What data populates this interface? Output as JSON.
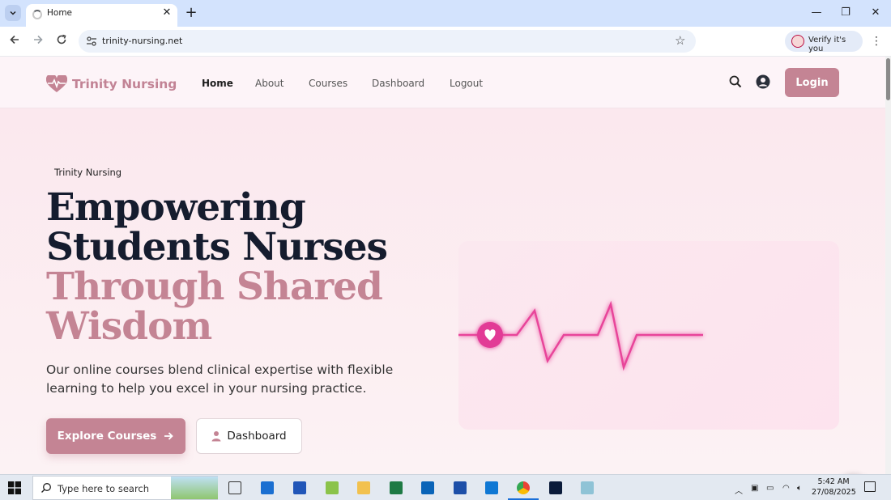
{
  "browser": {
    "tab_title": "Home",
    "tab_close": "✕",
    "new_tab": "+",
    "url": "trinity-nursing.net",
    "verify_label": "Verify it's you",
    "window_controls": {
      "minimize": "—",
      "restore": "❐",
      "close": "✕"
    }
  },
  "site": {
    "brand": "Trinity Nursing",
    "nav": [
      {
        "label": "Home"
      },
      {
        "label": "About"
      },
      {
        "label": "Courses"
      },
      {
        "label": "Dashboard"
      },
      {
        "label": "Logout"
      }
    ],
    "login_label": "Login"
  },
  "hero": {
    "eyebrow": "Trinity Nursing",
    "headline_line1": "Empowering",
    "headline_line2": "Students Nurses",
    "headline_line3": "Through Shared",
    "headline_line4": "Wisdom",
    "lead": "Our online courses blend clinical expertise with flexible learning to help you excel in your nursing practice.",
    "primary_cta": "Explore Courses",
    "secondary_cta": "Dashboard"
  },
  "taskbar": {
    "search_placeholder": "Type here to search",
    "time": "5:42 AM",
    "date": "27/08/2025"
  },
  "colors": {
    "brand_pink": "#c48494",
    "pulse_pink": "#e8449a",
    "heading_dark": "#151c2e"
  },
  "icons": [
    "heartbeat-logo-icon",
    "search-icon",
    "user-icon",
    "arrow-right-icon",
    "user-small-icon",
    "heart-icon",
    "chat-icon"
  ]
}
